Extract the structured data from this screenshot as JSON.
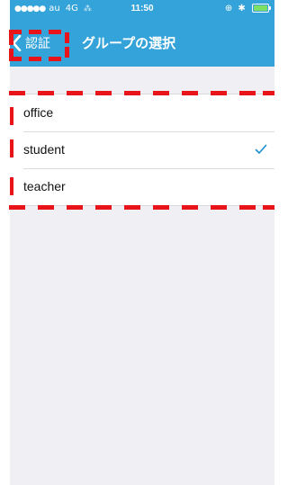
{
  "status_bar": {
    "signal_dots": "●●●●●",
    "carrier": "au",
    "network": "4G",
    "activity_indicator": "⁂",
    "time": "11:50",
    "icons": [
      "rotation-lock-icon",
      "bluetooth-icon",
      "battery-icon"
    ]
  },
  "nav": {
    "back_label": "認証",
    "title": "グループの選択"
  },
  "groups": [
    {
      "label": "office",
      "selected": false
    },
    {
      "label": "student",
      "selected": true
    },
    {
      "label": "teacher",
      "selected": false
    }
  ],
  "colors": {
    "nav_background": "#34a3d9",
    "page_background": "#efeff4",
    "checkmark": "#1a8fd0",
    "annotation": "#e8141a",
    "battery": "#7ddf64"
  }
}
